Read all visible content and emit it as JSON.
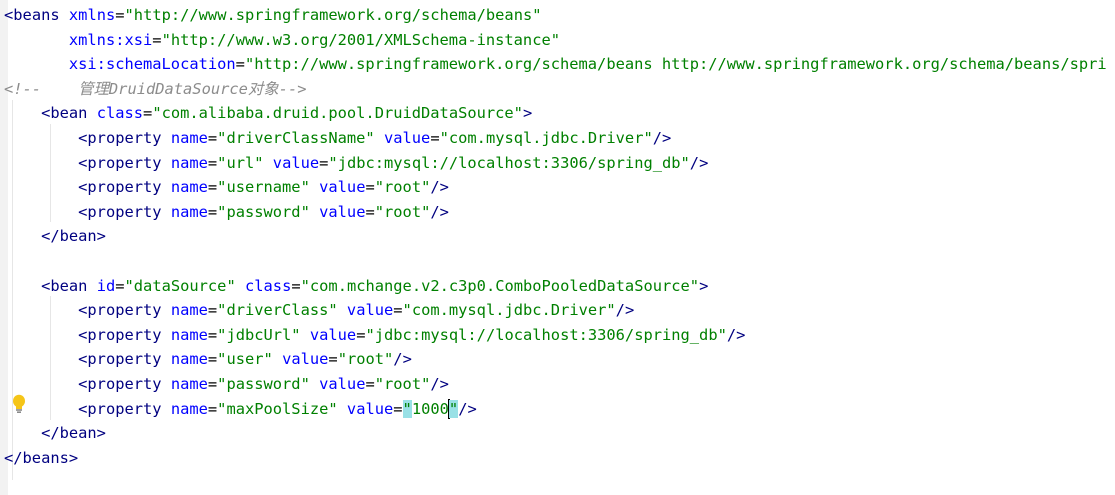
{
  "editor": {
    "language": "xml",
    "colors": {
      "background": "#ffffff",
      "tag": "#000080",
      "attribute": "#0000ff",
      "value": "#008000",
      "comment": "#8c8c8c",
      "brace_highlight": "#99e1e6"
    },
    "lines": [
      [
        {
          "t": "<",
          "c": "tag"
        },
        {
          "t": "beans",
          "c": "tag"
        },
        {
          "t": " ",
          "c": "plain"
        },
        {
          "t": "xmlns",
          "c": "attr"
        },
        {
          "t": "=",
          "c": "plain"
        },
        {
          "t": "\"http://www.springframework.org/schema/beans\"",
          "c": "val"
        }
      ],
      [
        {
          "t": "       ",
          "c": "plain"
        },
        {
          "t": "xmlns:xsi",
          "c": "attr"
        },
        {
          "t": "=",
          "c": "plain"
        },
        {
          "t": "\"http://www.w3.org/2001/XMLSchema-instance\"",
          "c": "val"
        }
      ],
      [
        {
          "t": "       ",
          "c": "plain"
        },
        {
          "t": "xsi:schemaLocation",
          "c": "attr"
        },
        {
          "t": "=",
          "c": "plain"
        },
        {
          "t": "\"http://www.springframework.org/schema/beans http://www.springframework.org/schema/beans/spri",
          "c": "val"
        }
      ],
      [
        {
          "t": "<!--    管理DruidDataSource对象-->",
          "c": "cmt"
        }
      ],
      [
        {
          "t": "    ",
          "c": "plain"
        },
        {
          "t": "<bean ",
          "c": "tag"
        },
        {
          "t": "class",
          "c": "attr"
        },
        {
          "t": "=",
          "c": "plain"
        },
        {
          "t": "\"com.alibaba.druid.pool.DruidDataSource\"",
          "c": "val"
        },
        {
          "t": ">",
          "c": "tag"
        }
      ],
      [
        {
          "t": "        ",
          "c": "plain"
        },
        {
          "t": "<property ",
          "c": "tag"
        },
        {
          "t": "name",
          "c": "attr"
        },
        {
          "t": "=",
          "c": "plain"
        },
        {
          "t": "\"driverClassName\"",
          "c": "val"
        },
        {
          "t": " ",
          "c": "plain"
        },
        {
          "t": "value",
          "c": "attr"
        },
        {
          "t": "=",
          "c": "plain"
        },
        {
          "t": "\"com.mysql.jdbc.Driver\"",
          "c": "val"
        },
        {
          "t": "/>",
          "c": "tag"
        }
      ],
      [
        {
          "t": "        ",
          "c": "plain"
        },
        {
          "t": "<property ",
          "c": "tag"
        },
        {
          "t": "name",
          "c": "attr"
        },
        {
          "t": "=",
          "c": "plain"
        },
        {
          "t": "\"url\"",
          "c": "val"
        },
        {
          "t": " ",
          "c": "plain"
        },
        {
          "t": "value",
          "c": "attr"
        },
        {
          "t": "=",
          "c": "plain"
        },
        {
          "t": "\"jdbc:mysql://localhost:3306/spring_db\"",
          "c": "val"
        },
        {
          "t": "/>",
          "c": "tag"
        }
      ],
      [
        {
          "t": "        ",
          "c": "plain"
        },
        {
          "t": "<property ",
          "c": "tag"
        },
        {
          "t": "name",
          "c": "attr"
        },
        {
          "t": "=",
          "c": "plain"
        },
        {
          "t": "\"username\"",
          "c": "val"
        },
        {
          "t": " ",
          "c": "plain"
        },
        {
          "t": "value",
          "c": "attr"
        },
        {
          "t": "=",
          "c": "plain"
        },
        {
          "t": "\"root\"",
          "c": "val"
        },
        {
          "t": "/>",
          "c": "tag"
        }
      ],
      [
        {
          "t": "        ",
          "c": "plain"
        },
        {
          "t": "<property ",
          "c": "tag"
        },
        {
          "t": "name",
          "c": "attr"
        },
        {
          "t": "=",
          "c": "plain"
        },
        {
          "t": "\"password\"",
          "c": "val"
        },
        {
          "t": " ",
          "c": "plain"
        },
        {
          "t": "value",
          "c": "attr"
        },
        {
          "t": "=",
          "c": "plain"
        },
        {
          "t": "\"root\"",
          "c": "val"
        },
        {
          "t": "/>",
          "c": "tag"
        }
      ],
      [
        {
          "t": "    ",
          "c": "plain"
        },
        {
          "t": "</bean>",
          "c": "tag"
        }
      ],
      [],
      [
        {
          "t": "    ",
          "c": "plain"
        },
        {
          "t": "<bean ",
          "c": "tag"
        },
        {
          "t": "id",
          "c": "attr"
        },
        {
          "t": "=",
          "c": "plain"
        },
        {
          "t": "\"dataSource\"",
          "c": "val"
        },
        {
          "t": " ",
          "c": "plain"
        },
        {
          "t": "class",
          "c": "attr"
        },
        {
          "t": "=",
          "c": "plain"
        },
        {
          "t": "\"com.mchange.v2.c3p0.ComboPooledDataSource\"",
          "c": "val"
        },
        {
          "t": ">",
          "c": "tag"
        }
      ],
      [
        {
          "t": "        ",
          "c": "plain"
        },
        {
          "t": "<property ",
          "c": "tag"
        },
        {
          "t": "name",
          "c": "attr"
        },
        {
          "t": "=",
          "c": "plain"
        },
        {
          "t": "\"driverClass\"",
          "c": "val"
        },
        {
          "t": " ",
          "c": "plain"
        },
        {
          "t": "value",
          "c": "attr"
        },
        {
          "t": "=",
          "c": "plain"
        },
        {
          "t": "\"com.mysql.jdbc.Driver\"",
          "c": "val"
        },
        {
          "t": "/>",
          "c": "tag"
        }
      ],
      [
        {
          "t": "        ",
          "c": "plain"
        },
        {
          "t": "<property ",
          "c": "tag"
        },
        {
          "t": "name",
          "c": "attr"
        },
        {
          "t": "=",
          "c": "plain"
        },
        {
          "t": "\"jdbcUrl\"",
          "c": "val"
        },
        {
          "t": " ",
          "c": "plain"
        },
        {
          "t": "value",
          "c": "attr"
        },
        {
          "t": "=",
          "c": "plain"
        },
        {
          "t": "\"jdbc:mysql://localhost:3306/spring_db\"",
          "c": "val"
        },
        {
          "t": "/>",
          "c": "tag"
        }
      ],
      [
        {
          "t": "        ",
          "c": "plain"
        },
        {
          "t": "<property ",
          "c": "tag"
        },
        {
          "t": "name",
          "c": "attr"
        },
        {
          "t": "=",
          "c": "plain"
        },
        {
          "t": "\"user\"",
          "c": "val"
        },
        {
          "t": " ",
          "c": "plain"
        },
        {
          "t": "value",
          "c": "attr"
        },
        {
          "t": "=",
          "c": "plain"
        },
        {
          "t": "\"root\"",
          "c": "val"
        },
        {
          "t": "/>",
          "c": "tag"
        }
      ],
      [
        {
          "t": "        ",
          "c": "plain"
        },
        {
          "t": "<property ",
          "c": "tag"
        },
        {
          "t": "name",
          "c": "attr"
        },
        {
          "t": "=",
          "c": "plain"
        },
        {
          "t": "\"password\"",
          "c": "val"
        },
        {
          "t": " ",
          "c": "plain"
        },
        {
          "t": "value",
          "c": "attr"
        },
        {
          "t": "=",
          "c": "plain"
        },
        {
          "t": "\"root\"",
          "c": "val"
        },
        {
          "t": "/>",
          "c": "tag"
        }
      ],
      [
        {
          "t": "        ",
          "c": "plain"
        },
        {
          "t": "<property ",
          "c": "tag"
        },
        {
          "t": "name",
          "c": "attr"
        },
        {
          "t": "=",
          "c": "plain"
        },
        {
          "t": "\"maxPoolSize\"",
          "c": "val"
        },
        {
          "t": " ",
          "c": "plain"
        },
        {
          "t": "value",
          "c": "attr"
        },
        {
          "t": "=",
          "c": "plain"
        },
        {
          "t": "\"",
          "c": "val",
          "hl": true
        },
        {
          "t": "1000",
          "c": "val"
        },
        {
          "t": "\"",
          "c": "val",
          "hl": true,
          "caret_before": true
        },
        {
          "t": "/>",
          "c": "tag"
        }
      ],
      [
        {
          "t": "    ",
          "c": "plain"
        },
        {
          "t": "</bean>",
          "c": "tag"
        }
      ],
      [
        {
          "t": "</beans>",
          "c": "tag"
        }
      ]
    ],
    "intention_icon": "lightbulb-icon",
    "intention_line": 17
  }
}
